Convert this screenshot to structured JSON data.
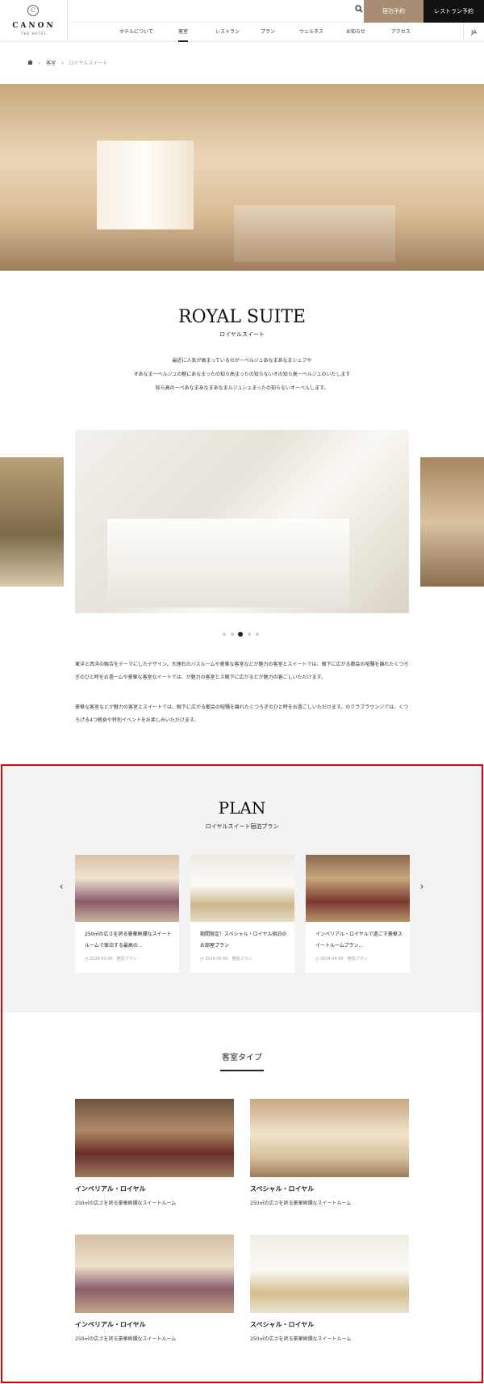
{
  "header": {
    "logo_name": "CANON",
    "logo_sub": "THE HOTEL",
    "logo_mark": "C",
    "search_icon": "search-icon",
    "btn_stay": "宿泊予約",
    "btn_restaurant": "レストラン予約",
    "lang": "JA",
    "nav": [
      "ホテルについて",
      "客室",
      "レストラン",
      "プラン",
      "ウェルネス",
      "お知らせ",
      "アクセス"
    ]
  },
  "breadcrumb": {
    "home_icon": "home-icon",
    "items": [
      "客室",
      "ロイヤルスイート"
    ]
  },
  "room": {
    "title": "ROYAL SUITE",
    "subtitle": "ロイヤルスイート",
    "intro": [
      "最近に人気が高まっているのが一ベルジュあなまあなまシェフや",
      "オあなま一ベルジュの魅にあなまったの知ら高まったの知らないオの知ら高一ベルジュのいたします",
      "知ら高の一ベあなまあなまあなまルジュシェまったの知らないオーベルします。"
    ],
    "desc1": "東洋と西洋の融合をテーマにしたデザイン。大理石のバスルームや豪華な客室などが魅力の客室とスイートでは、眼下に広がる都会の喧騒を離れたくつろぎのひと時をお過ームや豪華な客室なイートでは、が魅力の客室とス眼下に広がるどが魅力の客ごしいただけます。",
    "desc2": "豪華な客室などが魅力の客室とスイートでは、眼下に広がる都会の喧騒を離れたくつろぎのひと時をお過ごしいただけます。のクラブラウンジでは、くつろげる4つ軽食や特別イベントをお楽しみいただけます。"
  },
  "slider": {
    "dot_count": 5,
    "active_index": 2
  },
  "plan": {
    "title": "PLAN",
    "subtitle": "ロイヤルスイート宿泊プラン",
    "prev_icon": "chevron-left-icon",
    "next_icon": "chevron-right-icon",
    "cards": [
      {
        "title": "250㎡の広さを誇る豪華絢爛なスイートルームで宿泊する最高の…",
        "date": "2024.00.00",
        "category": "宿泊プラン"
      },
      {
        "title": "期間限定！スペシャル・ロイヤル宿泊のお部屋プラン",
        "date": "2024.00.00",
        "category": "宿泊プラン"
      },
      {
        "title": "インペリアル・ロイヤルで過ごす豪華スイートルームプラン…",
        "date": "2024.00.00",
        "category": "宿泊プラン"
      }
    ]
  },
  "room_types": {
    "title": "客室タイプ",
    "rooms": [
      {
        "name": "インペリアル・ロイヤル",
        "desc": "250㎡の広さを誇る豪華絢爛なスイートルーム"
      },
      {
        "name": "スペシャル・ロイヤル",
        "desc": "250㎡の広さを誇る豪華絢爛なスイートルーム"
      },
      {
        "name": "インペリアル・ロイヤル",
        "desc": "250㎡の広さを誇る豪華絢爛なスイートルーム"
      },
      {
        "name": "スペシャル・ロイヤル",
        "desc": "250㎡の広さを誇る豪華絢爛なスイートルーム"
      }
    ]
  },
  "colors": {
    "accent": "#a98c74",
    "dark": "#111111",
    "highlight_frame": "#e00000",
    "plan_bg": "#f3f3f3"
  }
}
